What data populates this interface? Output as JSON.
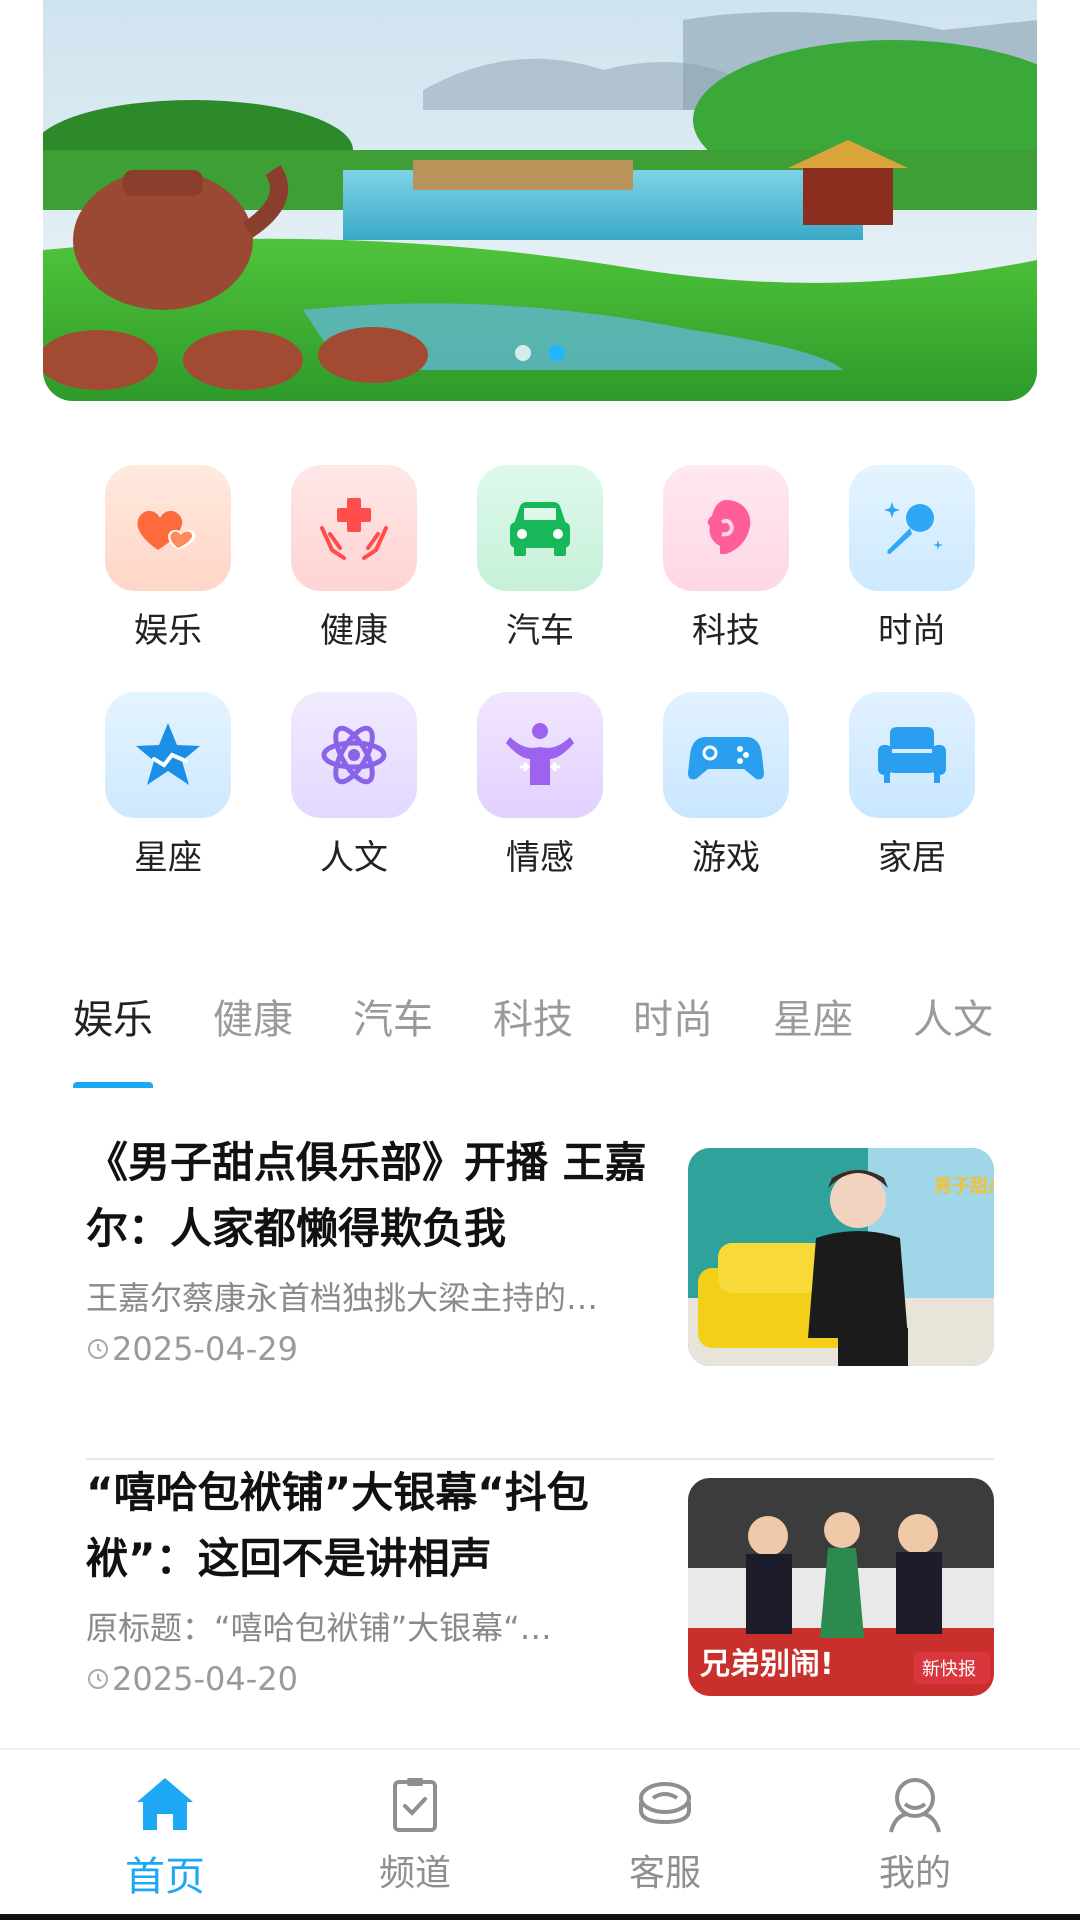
{
  "banner": {
    "slide_count": 2,
    "active_slide": 2
  },
  "categories": [
    {
      "label": "娱乐",
      "icon": "hearts-icon",
      "bg": "#ffe6dc",
      "color": "#ff6a3d"
    },
    {
      "label": "健康",
      "icon": "medical-hands-icon",
      "bg": "#ffe0e0",
      "color": "#ff4d4d"
    },
    {
      "label": "汽车",
      "icon": "car-icon",
      "bg": "#d7f7e6",
      "color": "#18b85a"
    },
    {
      "label": "科技",
      "icon": "profile-head-icon",
      "bg": "#ffe3ef",
      "color": "#ff5e98"
    },
    {
      "label": "时尚",
      "icon": "microphone-icon",
      "bg": "#dcf0ff",
      "color": "#2ea8f5"
    },
    {
      "label": "星座",
      "icon": "star-icon",
      "bg": "#dcf0ff",
      "color": "#1b8fe6"
    },
    {
      "label": "人文",
      "icon": "atom-icon",
      "bg": "#ece5ff",
      "color": "#8a63e8"
    },
    {
      "label": "情感",
      "icon": "person-arms-icon",
      "bg": "#ece0ff",
      "color": "#9b63f0"
    },
    {
      "label": "游戏",
      "icon": "gamepad-icon",
      "bg": "#d9efff",
      "color": "#2a9ff0"
    },
    {
      "label": "家居",
      "icon": "sofa-icon",
      "bg": "#d9efff",
      "color": "#2a9ff0"
    }
  ],
  "tabs": [
    "娱乐",
    "健康",
    "汽车",
    "科技",
    "时尚",
    "星座",
    "人文"
  ],
  "active_tab": "娱乐",
  "articles": [
    {
      "title": "《男子甜点俱乐部》开播 王嘉尔：人家都懒得欺负我",
      "summary": "王嘉尔蔡康永首档独挑大梁主持的…",
      "date": "2025-04-29",
      "thumb_overlay": "男子甜点俱乐部"
    },
    {
      "title": "“嘻哈包袱铺”大银幕“抖包袱”：这回不是讲相声",
      "summary": "原标题：“嘻哈包袱铺”大银幕“…",
      "date": "2025-04-20",
      "thumb_overlay": "兄弟别闹!",
      "thumb_badge": "新快报"
    }
  ],
  "bottom_nav": [
    {
      "label": "首页",
      "icon": "home-icon",
      "active": true
    },
    {
      "label": "频道",
      "icon": "clipboard-check-icon",
      "active": false
    },
    {
      "label": "客服",
      "icon": "service-icon",
      "active": false
    },
    {
      "label": "我的",
      "icon": "user-icon",
      "active": false
    }
  ],
  "colors": {
    "accent": "#1ea7f2",
    "text_primary": "#222222",
    "text_secondary": "#8a8a8a"
  }
}
